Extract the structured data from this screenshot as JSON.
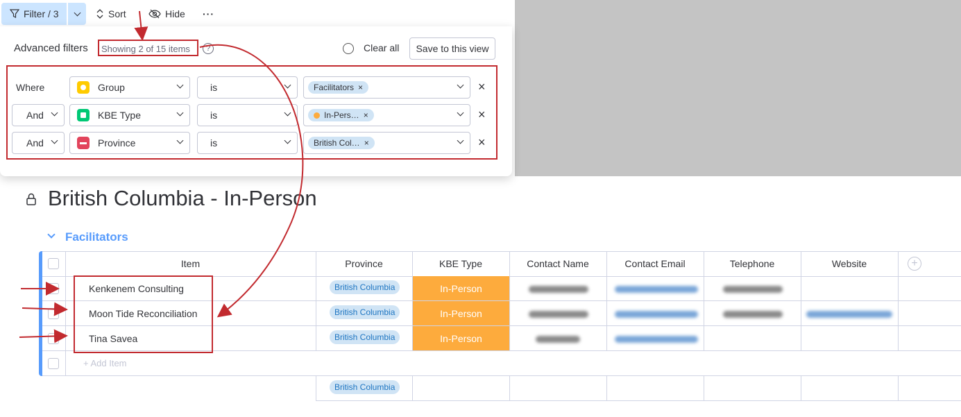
{
  "toolbar": {
    "filter_label": "Filter / 3",
    "sort_label": "Sort",
    "hide_label": "Hide",
    "more_label": "···"
  },
  "filters_panel": {
    "title": "Advanced filters",
    "showing": "Showing 2 of 15 items",
    "help": "?",
    "clear_all": "Clear all",
    "save_view": "Save to this view",
    "rows": [
      {
        "conj": "Where",
        "column": "Group",
        "column_icon_color": "#ffcb00",
        "operator": "is",
        "value": "Facilitators"
      },
      {
        "conj": "And",
        "column": "KBE Type",
        "column_icon_color": "#00c875",
        "operator": "is",
        "value": "In-Pers…",
        "value_dot_color": "#fdab3d"
      },
      {
        "conj": "And",
        "column": "Province",
        "column_icon_color": "#e2445c",
        "operator": "is",
        "value": "British Col…"
      }
    ],
    "remove_icon": "×",
    "chip_remove": "×"
  },
  "board": {
    "title": "British Columbia - In-Person",
    "group_title": "Facilitators",
    "columns": [
      "Item",
      "Province",
      "KBE Type",
      "Contact Name",
      "Contact Email",
      "Telephone",
      "Website"
    ],
    "rows": [
      {
        "item": "Kenkenem Consulting",
        "province": "British Columbia",
        "kbe": "In-Person"
      },
      {
        "item": "Moon Tide Reconciliation",
        "province": "British Columbia",
        "kbe": "In-Person"
      },
      {
        "item": "Tina Savea",
        "province": "British Columbia",
        "kbe": "In-Person"
      }
    ],
    "add_item": "+ Add Item",
    "summary_province": "British Columbia",
    "add_column": "+"
  },
  "colors": {
    "accent": "#579bfc",
    "kbe_orange": "#fdab3d",
    "annotation_red": "#c22a2f"
  }
}
